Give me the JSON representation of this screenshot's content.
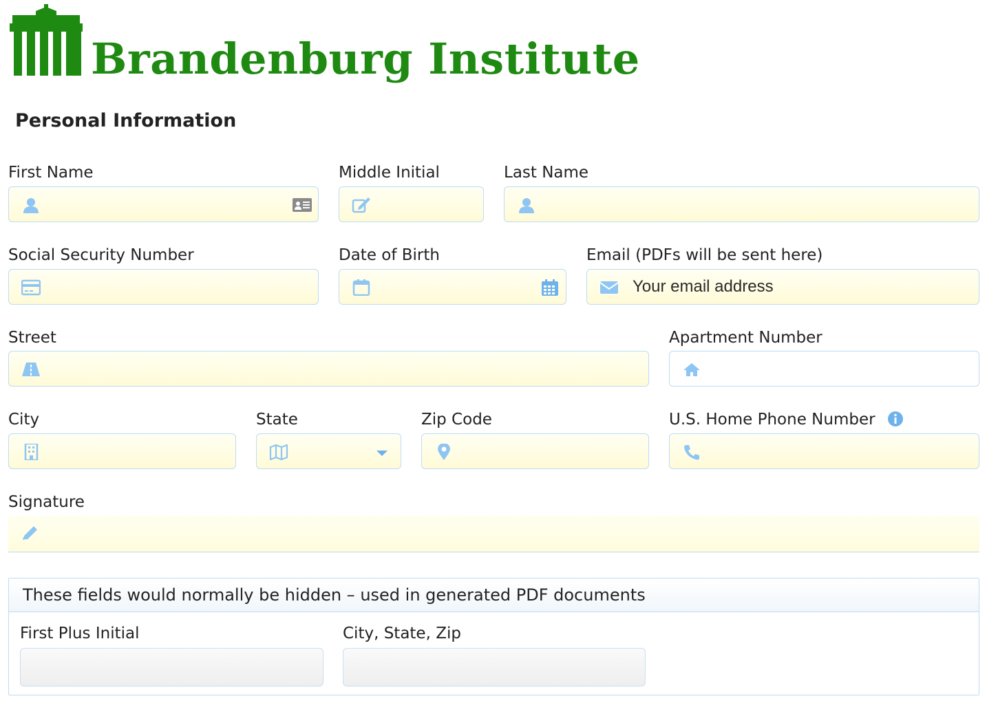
{
  "brand": {
    "name": "Brandenburg Institute",
    "color": "#1f8a12",
    "logo_icon": "brandenburg-gate-icon"
  },
  "section_title": "Personal Information",
  "fields": {
    "first_name": {
      "label": "First Name",
      "value": "",
      "icon": "user-icon",
      "right_icon": "id-card-icon"
    },
    "middle_initial": {
      "label": "Middle Initial",
      "value": "",
      "icon": "edit-icon"
    },
    "last_name": {
      "label": "Last Name",
      "value": "",
      "icon": "user-icon"
    },
    "ssn": {
      "label": "Social Security Number",
      "value": "",
      "icon": "credit-card-icon"
    },
    "dob": {
      "label": "Date of Birth",
      "value": "",
      "icon": "calendar-icon",
      "right_icon": "calendar-grid-icon"
    },
    "email": {
      "label": "Email (PDFs will be sent here)",
      "placeholder": "Your email address",
      "icon": "envelope-icon"
    },
    "street": {
      "label": "Street",
      "value": "",
      "icon": "road-icon"
    },
    "apartment": {
      "label": "Apartment Number",
      "value": "",
      "icon": "home-icon"
    },
    "city": {
      "label": "City",
      "value": "",
      "icon": "building-icon"
    },
    "state": {
      "label": "State",
      "value": "",
      "icon": "map-icon",
      "right_icon": "caret-down-icon"
    },
    "zip": {
      "label": "Zip Code",
      "value": "",
      "icon": "map-marker-icon"
    },
    "phone": {
      "label": "U.S. Home Phone Number",
      "value": "",
      "icon": "phone-icon",
      "info_icon": "info-icon"
    },
    "signature": {
      "label": "Signature",
      "icon": "pencil-icon"
    }
  },
  "hidden_panel": {
    "title": "These fields would normally be hidden – used in generated PDF documents",
    "first_plus_initial": {
      "label": "First Plus Initial",
      "value": ""
    },
    "city_state_zip": {
      "label": "City, State, Zip",
      "value": ""
    }
  },
  "colors": {
    "icon_blue": "#8ec5f2",
    "field_border": "#bcdcf5",
    "field_fill": "#fffbd8"
  }
}
